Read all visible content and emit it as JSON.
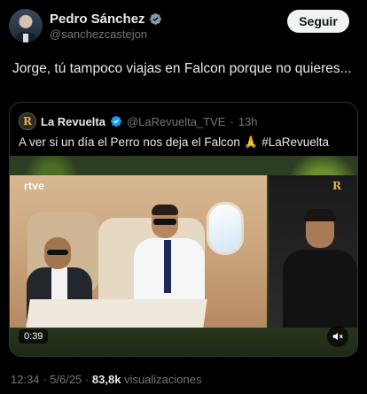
{
  "author": {
    "name": "Pedro Sánchez",
    "handle": "@sanchezcastejon",
    "verified_color": "#829aab",
    "follow_label": "Seguir"
  },
  "tweet": {
    "text": "Jorge, tú tampoco viajas en Falcon porque no quieres..."
  },
  "quote": {
    "avatar_letter": "R",
    "name": "La Revuelta",
    "handle": "@LaRevuelta_TVE",
    "separator": "·",
    "time": "13h",
    "text": "A ver si un día el Perro nos deja el Falcon 🙏 #LaRevuelta",
    "video": {
      "broadcaster": "rtve",
      "corner_logo": "R",
      "duration": "0:39",
      "mute_icon": "speaker-muted-icon"
    },
    "verified_color": "#1d9bf0"
  },
  "meta": {
    "time": "12:34",
    "sep1": "·",
    "date": "5/6/25",
    "sep2": "·",
    "views_count": "83,8k",
    "views_label": "visualizaciones"
  }
}
